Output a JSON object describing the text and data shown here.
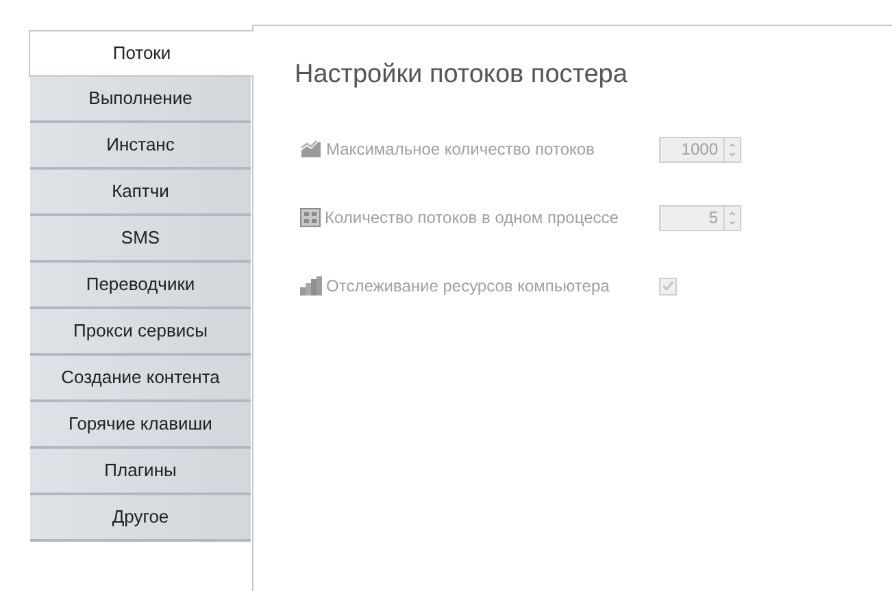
{
  "tabs": [
    {
      "label": "Потоки",
      "selected": true
    },
    {
      "label": "Выполнение",
      "selected": false
    },
    {
      "label": "Инстанс",
      "selected": false
    },
    {
      "label": "Каптчи",
      "selected": false
    },
    {
      "label": "SMS",
      "selected": false
    },
    {
      "label": "Переводчики",
      "selected": false
    },
    {
      "label": "Прокси сервисы",
      "selected": false
    },
    {
      "label": "Создание контента",
      "selected": false
    },
    {
      "label": "Горячие клавиши",
      "selected": false
    },
    {
      "label": "Плагины",
      "selected": false
    },
    {
      "label": "Другое",
      "selected": false
    }
  ],
  "panel": {
    "title": "Настройки потоков постера",
    "settings": [
      {
        "kind": "spin",
        "label": "Максимальное количество потоков",
        "value": "1000",
        "disabled": true
      },
      {
        "kind": "spin",
        "label": "Количество потоков в одном процессе",
        "value": "5",
        "disabled": true
      },
      {
        "kind": "checkbox",
        "label": "Отслеживание ресурсов компьютера",
        "checked": true,
        "disabled": true
      }
    ]
  }
}
